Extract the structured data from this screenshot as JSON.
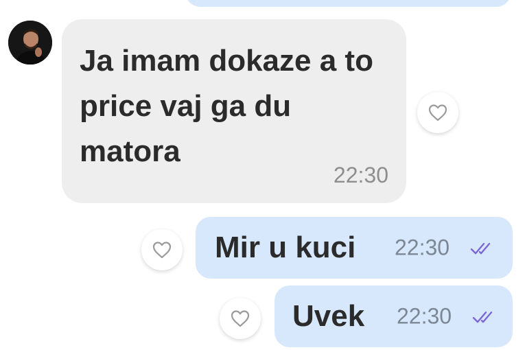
{
  "colors": {
    "incoming_bubble": "#eeeeee",
    "outgoing_bubble": "#d8e8fc",
    "read_check": "#7a66d6",
    "timestamp": "#8e8e8e"
  },
  "messages": [
    {
      "direction": "incoming",
      "text": "Ja imam dokaze a to price vaj ga du matora",
      "time": "22:30",
      "reaction_icon": "heart-outline-icon"
    },
    {
      "direction": "outgoing",
      "text": "Mir u kuci",
      "time": "22:30",
      "status_icon": "double-check-icon",
      "reaction_icon": "heart-outline-icon"
    },
    {
      "direction": "outgoing",
      "text": "Uvek",
      "time": "22:30",
      "status_icon": "double-check-icon",
      "reaction_icon": "heart-outline-icon"
    }
  ]
}
